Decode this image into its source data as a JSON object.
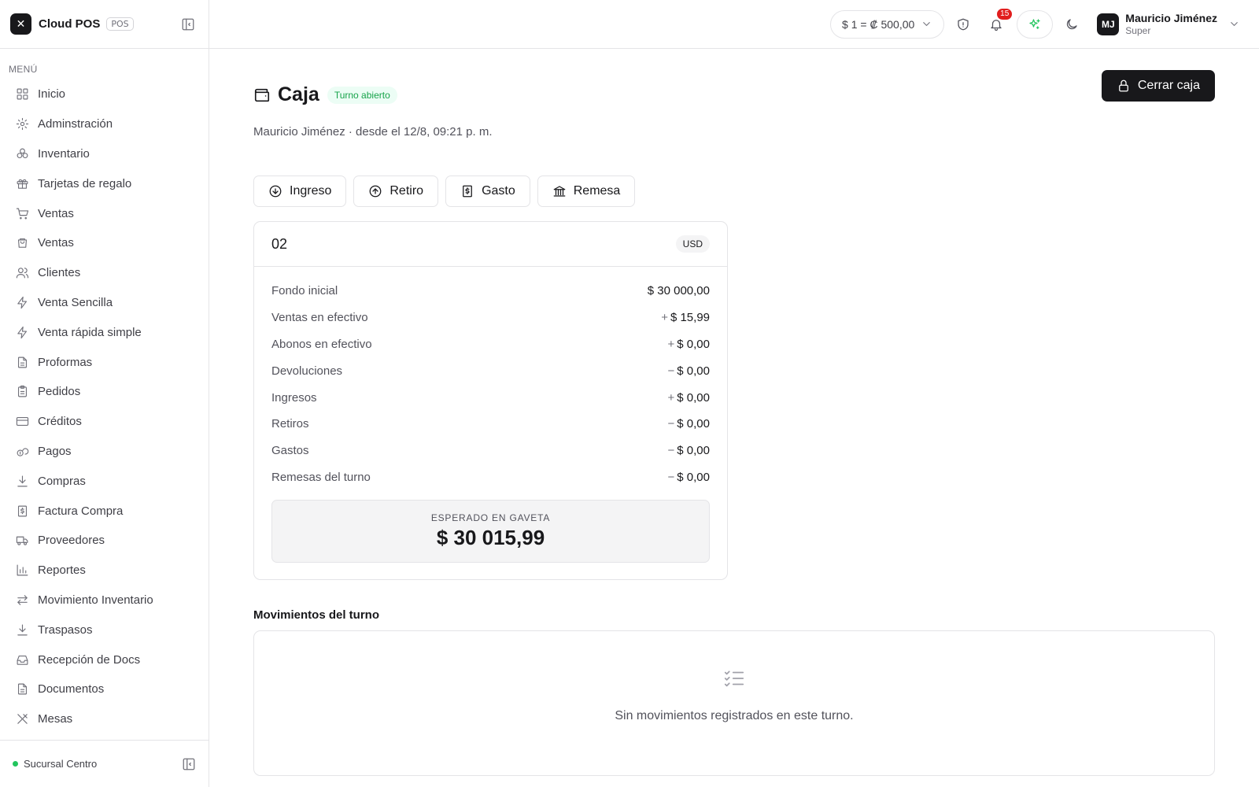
{
  "app": {
    "name": "Cloud POS",
    "badge": "POS",
    "logo_glyph": "✕"
  },
  "sidebar": {
    "caption": "MENÚ",
    "items": [
      {
        "label": "Inicio",
        "icon": "grid-icon"
      },
      {
        "label": "Adminstración",
        "icon": "gear-icon"
      },
      {
        "label": "Inventario",
        "icon": "boxes-icon"
      },
      {
        "label": "Tarjetas de regalo",
        "icon": "gift-icon"
      },
      {
        "label": "Ventas",
        "icon": "cart-icon"
      },
      {
        "label": "Ventas",
        "icon": "shopping-bag-icon"
      },
      {
        "label": "Clientes",
        "icon": "users-icon"
      },
      {
        "label": "Venta Sencilla",
        "icon": "lightning-icon"
      },
      {
        "label": "Venta rápida simple",
        "icon": "lightning-icon"
      },
      {
        "label": "Proformas",
        "icon": "document-icon"
      },
      {
        "label": "Pedidos",
        "icon": "clipboard-icon"
      },
      {
        "label": "Créditos",
        "icon": "credit-card-icon"
      },
      {
        "label": "Pagos",
        "icon": "coins-icon"
      },
      {
        "label": "Compras",
        "icon": "download-icon"
      },
      {
        "label": "Factura Compra",
        "icon": "receipt-icon"
      },
      {
        "label": "Proveedores",
        "icon": "truck-icon"
      },
      {
        "label": "Reportes",
        "icon": "bar-chart-icon"
      },
      {
        "label": "Movimiento Inventario",
        "icon": "arrows-left-right-icon"
      },
      {
        "label": "Traspasos",
        "icon": "download-icon"
      },
      {
        "label": "Recepción de Docs",
        "icon": "inbox-icon"
      },
      {
        "label": "Documentos",
        "icon": "document-icon"
      },
      {
        "label": "Mesas",
        "icon": "utensils-icon"
      }
    ],
    "footer": {
      "branch": "Sucursal Centro",
      "status_color": "#22c55e"
    }
  },
  "topbar": {
    "exchange_rate": "$ 1 =  ₡ 500,00",
    "notifications_count": "15",
    "user": {
      "initials": "MJ",
      "name": "Mauricio Jiménez",
      "role": "Super"
    }
  },
  "page": {
    "title": "Caja",
    "status": "Turno abierto",
    "subtitle": "Mauricio Jiménez · desde el 12/8, 09:21 p. m.",
    "close_label": "Cerrar caja",
    "actions": [
      {
        "label": "Ingreso",
        "icon": "arrow-down-circle-icon"
      },
      {
        "label": "Retiro",
        "icon": "arrow-up-circle-icon"
      },
      {
        "label": "Gasto",
        "icon": "dollar-receipt-icon"
      },
      {
        "label": "Remesa",
        "icon": "bank-icon"
      }
    ]
  },
  "drawer": {
    "name": "02",
    "currency": "USD",
    "lines": [
      {
        "label": "Fondo inicial",
        "sign": "",
        "value": "$ 30 000,00"
      },
      {
        "label": "Ventas en efectivo",
        "sign": "+",
        "value": "$ 15,99"
      },
      {
        "label": "Abonos en efectivo",
        "sign": "+",
        "value": "$ 0,00"
      },
      {
        "label": "Devoluciones",
        "sign": "−",
        "value": "$ 0,00"
      },
      {
        "label": "Ingresos",
        "sign": "+",
        "value": "$ 0,00"
      },
      {
        "label": "Retiros",
        "sign": "−",
        "value": "$ 0,00"
      },
      {
        "label": "Gastos",
        "sign": "−",
        "value": "$ 0,00"
      },
      {
        "label": "Remesas del turno",
        "sign": "−",
        "value": "$ 0,00"
      }
    ],
    "expected_label": "ESPERADO EN GAVETA",
    "expected_value": "$ 30 015,99"
  },
  "movements": {
    "title": "Movimientos del turno",
    "empty_text": "Sin movimientos registrados en este turno.",
    "empty_icon": "checklist-icon"
  }
}
